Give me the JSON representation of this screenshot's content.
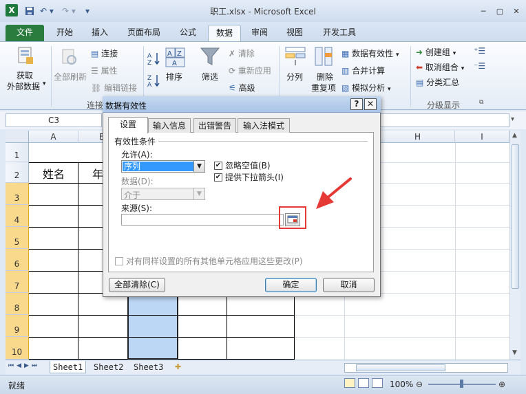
{
  "window": {
    "title": "职工.xlsx - Microsoft Excel"
  },
  "tabs": [
    "文件",
    "开始",
    "插入",
    "页面布局",
    "公式",
    "数据",
    "审阅",
    "视图",
    "开发工具"
  ],
  "ribbon": {
    "get_external_data": [
      "获取",
      "外部数据"
    ],
    "refresh_all": "全部刷新",
    "connections": "连接",
    "properties": "属性",
    "edit_links": "编辑链接",
    "connections_group": "连接",
    "sort": "排序",
    "filter": "筛选",
    "clear": "清除",
    "reapply": "重新应用",
    "advanced": "高级",
    "text_to_columns": "分列",
    "remove_duplicates": [
      "删除",
      "重复项"
    ],
    "data_validation": "数据有效性",
    "consolidate": "合并计算",
    "what_if": "模拟分析",
    "group": "创建组",
    "ungroup": "取消组合",
    "subtotal": "分类汇总",
    "outline_group": "分级显示"
  },
  "name_box": "C3",
  "columns": [
    "A",
    "B",
    "H",
    "I"
  ],
  "rows": [
    "1",
    "2",
    "3",
    "4",
    "5",
    "6",
    "7",
    "8",
    "9",
    "10"
  ],
  "cells": {
    "a2": "姓名",
    "b2": "年"
  },
  "sheets": [
    "Sheet1",
    "Sheet2",
    "Sheet3"
  ],
  "status": {
    "ready": "就绪",
    "zoom": "100%"
  },
  "dialog": {
    "title": "数据有效性",
    "tabs": [
      "设置",
      "输入信息",
      "出错警告",
      "输入法模式"
    ],
    "section": "有效性条件",
    "allow_label": "允许(A):",
    "allow_value": "序列",
    "data_label": "数据(D):",
    "data_value": "介于",
    "ignore_blank": "忽略空值(B)",
    "dropdown": "提供下拉箭头(I)",
    "source_label": "来源(S):",
    "apply_all": "对有同样设置的所有其他单元格应用这些更改(P)",
    "clear_all": "全部清除(C)",
    "ok": "确定",
    "cancel": "取消"
  },
  "colors": {
    "file_tab": "#2a7c3e",
    "selected_cells": "#bcd7f5",
    "highlight_box": "#e53935",
    "arrow": "#e53935"
  },
  "icons": [
    "excel-logo-icon",
    "save-icon",
    "undo-icon",
    "redo-icon",
    "help-icon",
    "source-picker-icon",
    "filter-icon",
    "sort-az-icon",
    "sort-za-icon"
  ]
}
